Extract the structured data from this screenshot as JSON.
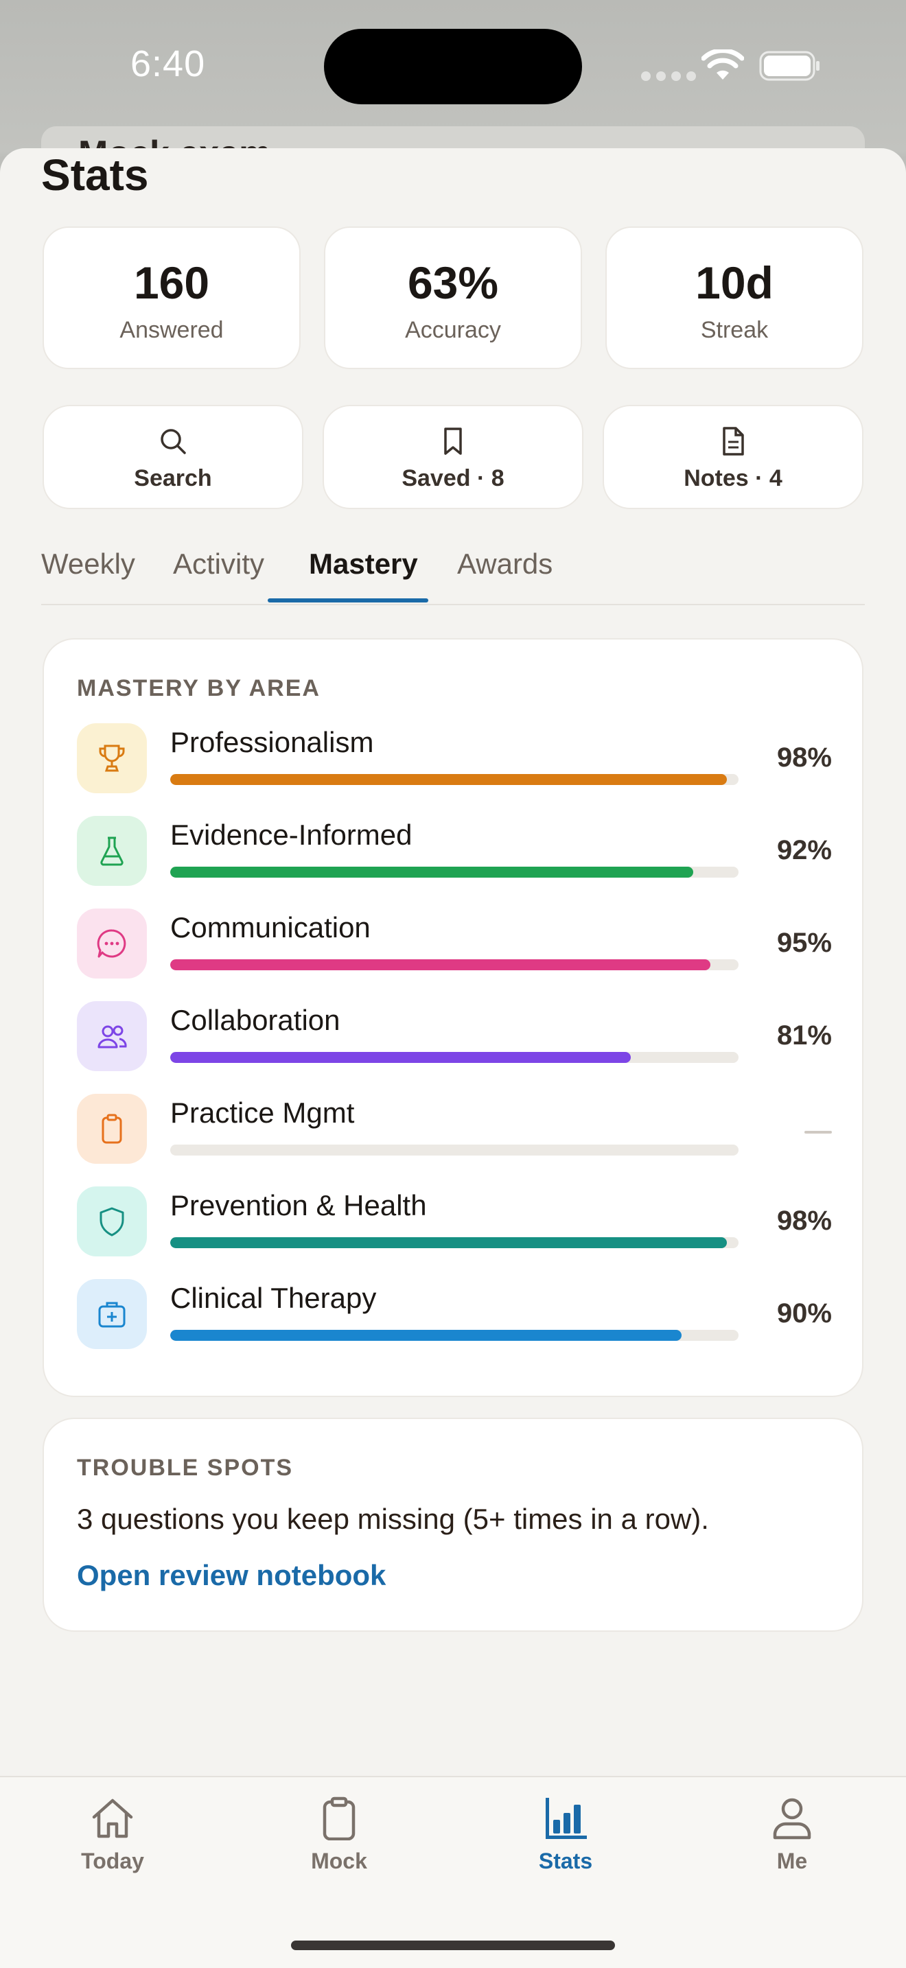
{
  "status_bar": {
    "time": "6:40"
  },
  "behind_card": {
    "title": "Mock exam"
  },
  "sheet": {
    "title": "Stats"
  },
  "stats": [
    {
      "value": "160",
      "label": "Answered"
    },
    {
      "value": "63%",
      "label": "Accuracy"
    },
    {
      "value": "10d",
      "label": "Streak"
    }
  ],
  "tools": [
    {
      "label": "Search",
      "icon": "search-icon"
    },
    {
      "label": "Saved · 8",
      "icon": "bookmark-icon"
    },
    {
      "label": "Notes · 4",
      "icon": "document-icon"
    }
  ],
  "tabs": [
    {
      "label": "Weekly"
    },
    {
      "label": "Activity"
    },
    {
      "label": "Mastery",
      "active": true
    },
    {
      "label": "Awards"
    }
  ],
  "mastery": {
    "heading": "MASTERY BY AREA",
    "areas": [
      {
        "name": "Professionalism",
        "pct": "98%",
        "value": 0.98,
        "color": "#d97b12",
        "icon_bg": "#fbf1d2",
        "icon": "trophy-icon"
      },
      {
        "name": "Evidence-Informed",
        "pct": "92%",
        "value": 0.92,
        "color": "#1fa352",
        "icon_bg": "#ddf5e4",
        "icon": "flask-icon"
      },
      {
        "name": "Communication",
        "pct": "95%",
        "value": 0.95,
        "color": "#df3a84",
        "icon_bg": "#fbe2ee",
        "icon": "chat-icon"
      },
      {
        "name": "Collaboration",
        "pct": "81%",
        "value": 0.81,
        "color": "#7d45e6",
        "icon_bg": "#ebe4fb",
        "icon": "users-icon"
      },
      {
        "name": "Practice Mgmt",
        "pct": "",
        "value": 0,
        "color": "#e6711c",
        "icon_bg": "#fde8d6",
        "icon": "clipboard-icon"
      },
      {
        "name": "Prevention & Health",
        "pct": "98%",
        "value": 0.98,
        "color": "#169083",
        "icon_bg": "#d5f5ee",
        "icon": "shield-icon"
      },
      {
        "name": "Clinical Therapy",
        "pct": "90%",
        "value": 0.9,
        "color": "#1a86cf",
        "icon_bg": "#ddeefb",
        "icon": "medkit-icon"
      }
    ]
  },
  "trouble": {
    "heading": "TROUBLE SPOTS",
    "text": "3 questions you keep missing (5+ times in a row).",
    "link": "Open review notebook"
  },
  "tabbar": [
    {
      "label": "Today",
      "icon": "home-icon"
    },
    {
      "label": "Mock",
      "icon": "clipboard-icon"
    },
    {
      "label": "Stats",
      "icon": "bar-chart-icon",
      "active": true
    },
    {
      "label": "Me",
      "icon": "person-icon"
    }
  ],
  "colors": {
    "accent": "#1a6aa8",
    "background": "#f4f3f0"
  }
}
